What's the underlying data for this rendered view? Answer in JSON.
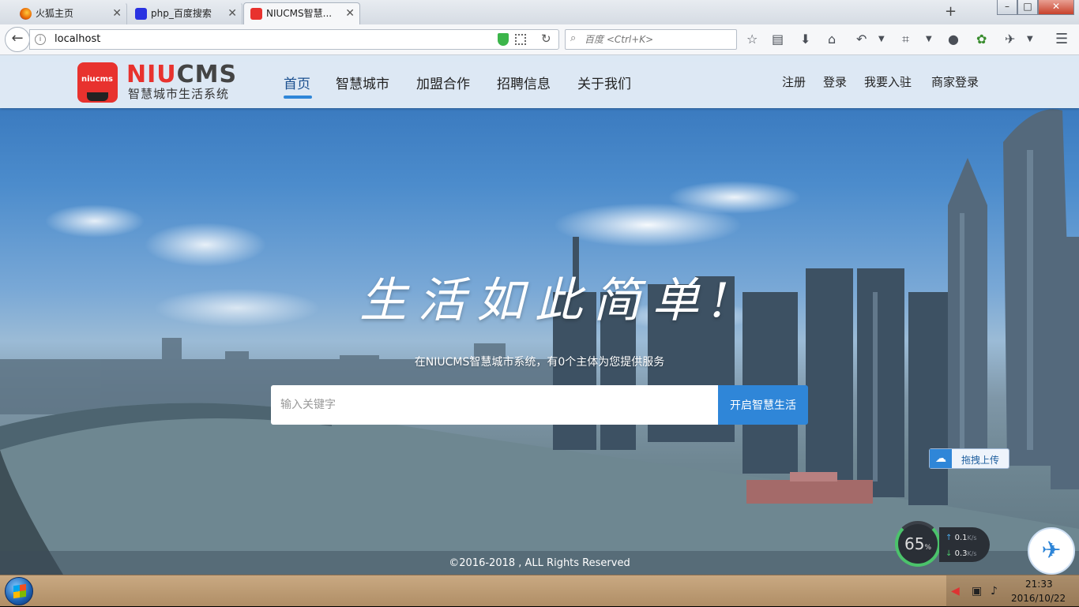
{
  "browser": {
    "tabs": [
      {
        "title": "火狐主页",
        "active": false
      },
      {
        "title": "php_百度搜索",
        "active": false
      },
      {
        "title": "NIUCMS智慧...",
        "active": true
      }
    ],
    "new_tab": "+",
    "window_buttons": {
      "minimize": "–",
      "maximize": "□",
      "close": "✕"
    },
    "url": "localhost",
    "search_placeholder": "百度 <Ctrl+K>",
    "toolbar_icons": [
      "bookmark-star-icon",
      "reader-icon",
      "download-icon",
      "home-icon",
      "undo-icon",
      "crop-icon",
      "chat-icon",
      "extension-icon",
      "mouse-gesture-icon",
      "menu-icon"
    ]
  },
  "site": {
    "logo_badge": "niucms",
    "logo_word_red": "NIU",
    "logo_word_gray": "CMS",
    "logo_subtitle": "智慧城市生活系统",
    "nav": [
      {
        "label": "首页",
        "active": true
      },
      {
        "label": "智慧城市",
        "active": false
      },
      {
        "label": "加盟合作",
        "active": false
      },
      {
        "label": "招聘信息",
        "active": false
      },
      {
        "label": "关于我们",
        "active": false
      }
    ],
    "right_nav": [
      "注册",
      "登录",
      "我要入驻",
      "商家登录"
    ],
    "slogan": "生活如此简单!",
    "subtitle": "在NIUCMS智慧城市系统，有0个主体为您提供服务",
    "search": {
      "placeholder": "输入关键字",
      "button": "开启智慧生活"
    },
    "upload_widget": "拖拽上传",
    "copyright": "©2016-2018 , ALL Rights Reserved",
    "accent_color": "#2f86d8",
    "brand_red": "#e8322e"
  },
  "net_meter": {
    "percent": "65",
    "percent_unit": "%",
    "up": "0.1",
    "down": "0.3",
    "unit": "K/s"
  },
  "taskbar": {
    "time": "21:33",
    "date": "2016/10/22"
  }
}
